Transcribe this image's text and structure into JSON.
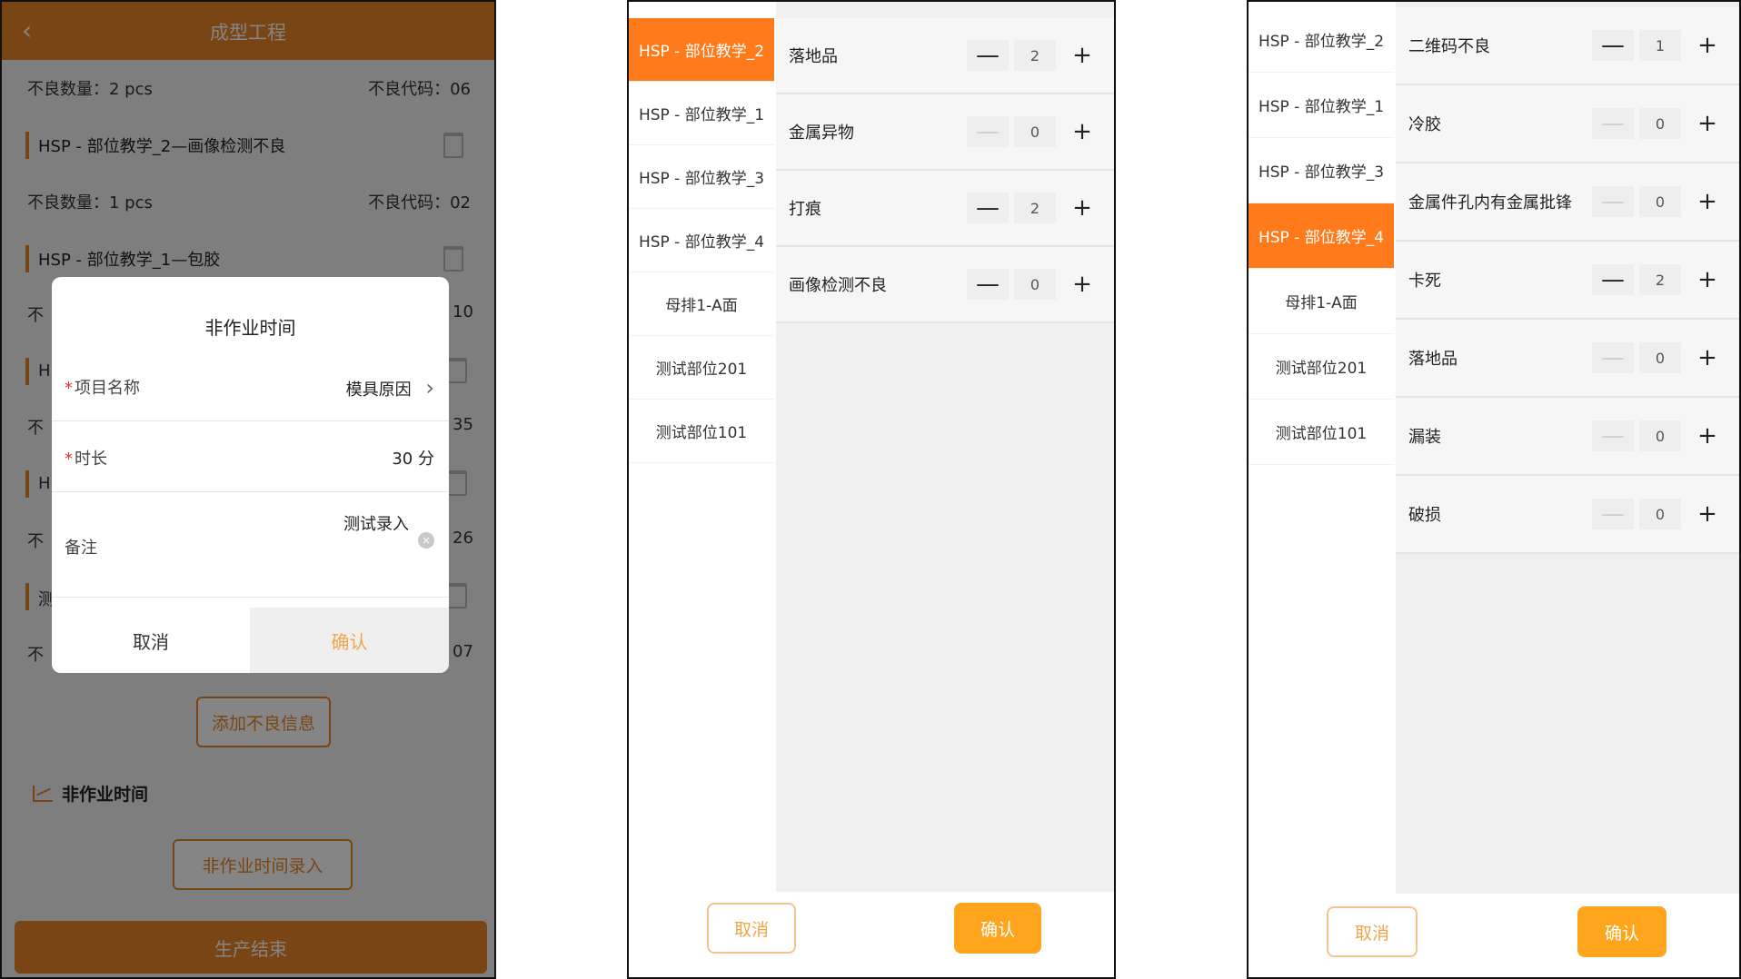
{
  "phone1": {
    "header": {
      "title": "成型工程",
      "back_icon": "chevron-left-icon"
    },
    "defect_rows": [
      {
        "qty": "不良数量：2 pcs",
        "code": "不良代码：06"
      },
      {
        "qty": "不良数量：1 pcs",
        "code": "不良代码：02"
      }
    ],
    "defect_items": [
      "HSP - 部位教学_2—画像检测不良",
      "HSP - 部位教学_1—包胶"
    ],
    "partial": {
      "qty_prefix": "不",
      "item_prefix_1": "H",
      "item_prefix_2": "H",
      "item_prefix_3": "测",
      "codes": [
        "10",
        "35",
        "26",
        "07"
      ]
    },
    "add_defect_label": "添加不良信息",
    "section_title": "非作业时间",
    "nonwork_entry_label": "非作业时间录入",
    "end_production_label": "生产结束",
    "accent_color": "#e8842a",
    "dialog": {
      "title": "非作业时间",
      "project_label": "项目名称",
      "project_value": "模具原因",
      "duration_label": "时长",
      "duration_value": "30 分",
      "remark_label": "备注",
      "remark_value": "测试录入",
      "required_mark": "*",
      "cancel": "取消",
      "confirm": "确认"
    }
  },
  "phone2": {
    "sidebar": [
      {
        "label": "HSP - 部位教学_2",
        "active": true
      },
      {
        "label": "HSP - 部位教学_1",
        "active": false
      },
      {
        "label": "HSP - 部位教学_3",
        "active": false
      },
      {
        "label": "HSP - 部位教学_4",
        "active": false
      },
      {
        "label": "母排1-A面",
        "active": false
      },
      {
        "label": "测试部位201",
        "active": false
      },
      {
        "label": "测试部位101",
        "active": false
      }
    ],
    "defects": [
      {
        "label": "落地品",
        "value": "2"
      },
      {
        "label": "金属异物",
        "value": "0"
      },
      {
        "label": "打痕",
        "value": "2"
      },
      {
        "label": "画像检测不良",
        "value": "0"
      }
    ],
    "cancel": "取消",
    "confirm": "确认"
  },
  "phone3": {
    "sidebar": [
      {
        "label": "HSP - 部位教学_2",
        "active": false
      },
      {
        "label": "HSP - 部位教学_1",
        "active": false
      },
      {
        "label": "HSP - 部位教学_3",
        "active": false
      },
      {
        "label": "HSP - 部位教学_4",
        "active": true
      },
      {
        "label": "母排1-A面",
        "active": false
      },
      {
        "label": "测试部位201",
        "active": false
      },
      {
        "label": "测试部位101",
        "active": false
      }
    ],
    "defects": [
      {
        "label": "二维码不良",
        "value": "1"
      },
      {
        "label": "冷胶",
        "value": "0"
      },
      {
        "label": "金属件孔内有金属批锋",
        "value": "0"
      },
      {
        "label": "卡死",
        "value": "2"
      },
      {
        "label": "落地品",
        "value": "0"
      },
      {
        "label": "漏装",
        "value": "0"
      },
      {
        "label": "破损",
        "value": "0"
      }
    ],
    "cancel": "取消",
    "confirm": "确认"
  },
  "symbols": {
    "minus": "—",
    "plus": "+",
    "chevron_right": "›",
    "chevron_left": "‹",
    "clear": "×"
  }
}
